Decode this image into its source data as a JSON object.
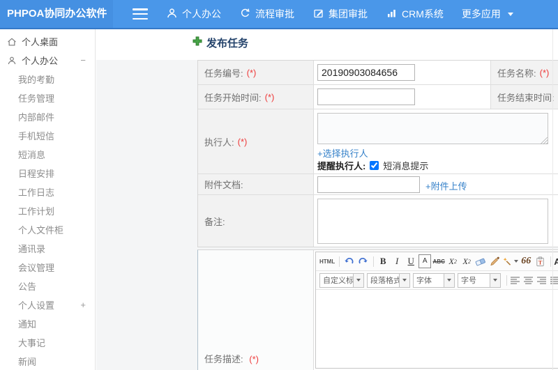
{
  "header": {
    "logo": "PHPOA协同办公软件",
    "nav": [
      {
        "label": "个人办公",
        "icon": "user-icon"
      },
      {
        "label": "流程审批",
        "icon": "workflow-icon"
      },
      {
        "label": "集团审批",
        "icon": "edit-icon"
      },
      {
        "label": "CRM系统",
        "icon": "bar-chart-icon"
      },
      {
        "label": "更多应用",
        "icon": "caret-down-icon"
      }
    ]
  },
  "sidebar": {
    "items": [
      {
        "label": "个人桌面"
      },
      {
        "label": "个人办公",
        "toggle": "−"
      },
      {
        "label": "我的考勤"
      },
      {
        "label": "任务管理"
      },
      {
        "label": "内部邮件"
      },
      {
        "label": "手机短信"
      },
      {
        "label": "短消息"
      },
      {
        "label": "日程安排"
      },
      {
        "label": "工作日志"
      },
      {
        "label": "工作计划"
      },
      {
        "label": "个人文件柜"
      },
      {
        "label": "通讯录"
      },
      {
        "label": "会议管理"
      },
      {
        "label": "公告"
      },
      {
        "label": "个人设置",
        "toggle": "+"
      },
      {
        "label": "通知"
      },
      {
        "label": "大事记"
      },
      {
        "label": "新闻"
      }
    ]
  },
  "form": {
    "title": "发布任务",
    "required_mark": "(*)",
    "task_no": {
      "label": "任务编号:",
      "value": "20190903084656"
    },
    "task_name": {
      "label": "任务名称:"
    },
    "start_time": {
      "label": "任务开始时间:"
    },
    "end_time": {
      "label": "任务结束时间:"
    },
    "executor": {
      "label": "执行人:",
      "select_link": "+选择执行人",
      "remind_label": "提醒执行人:",
      "sms_label": "短消息提示",
      "checkbox": "checked"
    },
    "attachment": {
      "label": "附件文档:",
      "upload_link": "+附件上传"
    },
    "note": {
      "label": "备注:"
    },
    "desc": {
      "label": "任务描述:"
    }
  },
  "editor": {
    "buttons": {
      "html": "HTML",
      "bold": "B",
      "italic": "I",
      "underline": "U",
      "fontbox": "A",
      "strike": "ABC",
      "sup_base": "X",
      "sup_exp": "2",
      "sub_base": "X",
      "sub_idx": "2",
      "quote": "66",
      "color": "A"
    },
    "selects": [
      {
        "label": "自定义标题"
      },
      {
        "label": "段落格式"
      },
      {
        "label": "字体"
      },
      {
        "label": "字号"
      }
    ]
  },
  "colors": {
    "header_blue": "#4a97e9",
    "link_blue": "#3581c9",
    "required_red": "#ee3b3b",
    "title_navy": "#24436b",
    "plus_green": "#47a447"
  }
}
